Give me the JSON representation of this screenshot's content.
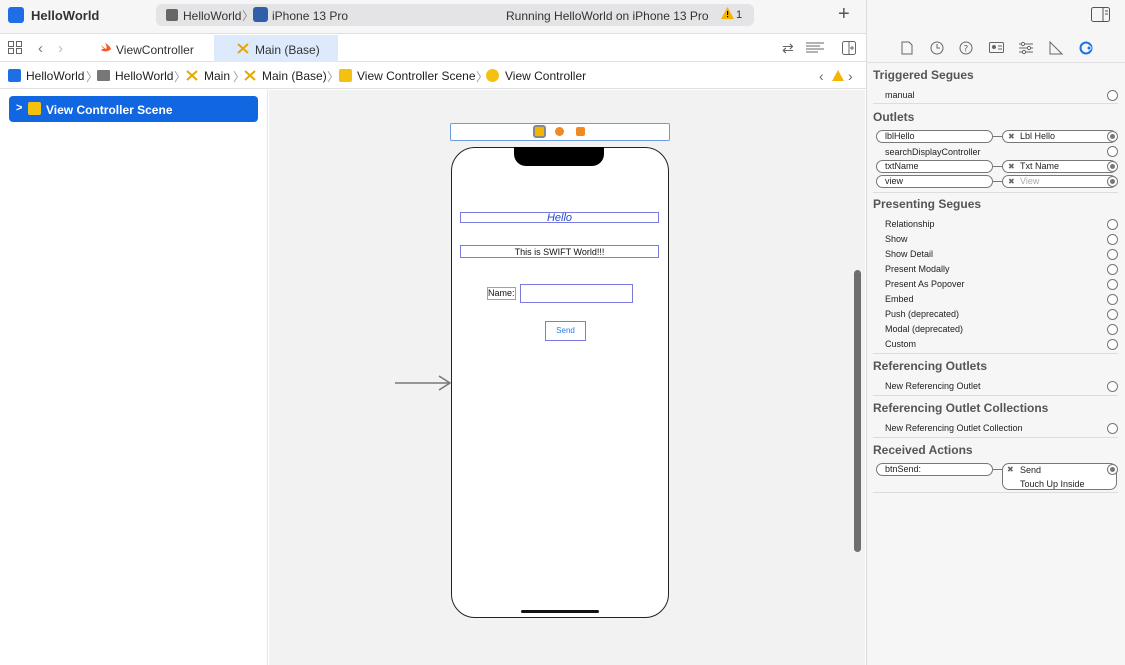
{
  "window": {
    "project": "HelloWorld",
    "scheme": "HelloWorld",
    "device": "iPhone 13 Pro",
    "status": "Running HelloWorld on iPhone 13 Pro",
    "warnings": "1"
  },
  "tabs": [
    {
      "label": "ViewController",
      "icon": "swift-file-icon"
    },
    {
      "label": "Main (Base)",
      "icon": "storyboard-icon",
      "selected": true
    }
  ],
  "jumpbar": [
    "HelloWorld",
    "HelloWorld",
    "Main",
    "Main (Base)",
    "View Controller Scene",
    "View Controller"
  ],
  "outline": {
    "item": "View Controller Scene"
  },
  "canvas": {
    "hello": "Hello",
    "swift": "This is SWIFT World!!!",
    "name_label": "Name:",
    "send": "Send"
  },
  "inspector": {
    "triggered_segues": {
      "title": "Triggered Segues",
      "items": [
        "manual"
      ]
    },
    "outlets": {
      "title": "Outlets",
      "items": [
        {
          "name": "lblHello",
          "target": "Lbl Hello"
        },
        {
          "name": "searchDisplayController",
          "target": ""
        },
        {
          "name": "txtName",
          "target": "Txt Name"
        },
        {
          "name": "view",
          "target": "View"
        }
      ]
    },
    "presenting_segues": {
      "title": "Presenting Segues",
      "items": [
        "Relationship",
        "Show",
        "Show Detail",
        "Present Modally",
        "Present As Popover",
        "Embed",
        "Push (deprecated)",
        "Modal (deprecated)",
        "Custom"
      ]
    },
    "referencing_outlets": {
      "title": "Referencing Outlets",
      "items": [
        "New Referencing Outlet"
      ]
    },
    "referencing_outlet_collections": {
      "title": "Referencing Outlet Collections",
      "items": [
        "New Referencing Outlet Collection"
      ]
    },
    "received_actions": {
      "title": "Received Actions",
      "items": [
        {
          "name": "btnSend:",
          "target": "Send",
          "event": "Touch Up Inside"
        }
      ]
    }
  },
  "colors": {
    "selection": "#1166e2",
    "accent": "#2c7be5",
    "warning": "#f5b400"
  }
}
